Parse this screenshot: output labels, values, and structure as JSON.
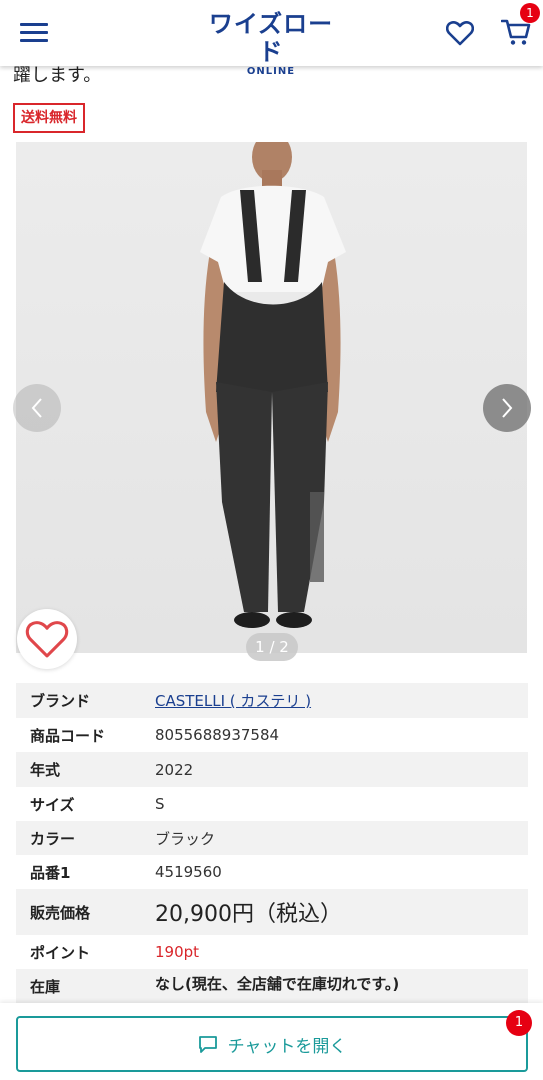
{
  "header": {
    "logo_main": "ワイズロード",
    "logo_sub": "ONLINE",
    "cart_count": "1"
  },
  "description_tail": "躍します。",
  "badge_free_shipping": "送料無料",
  "gallery": {
    "pager": "1 / 2"
  },
  "specs": [
    {
      "label": "ブランド",
      "value": "CASTELLI ( カステリ )"
    },
    {
      "label": "商品コード",
      "value": "8055688937584"
    },
    {
      "label": "年式",
      "value": "2022"
    },
    {
      "label": "サイズ",
      "value": "S"
    },
    {
      "label": "カラー",
      "value": "ブラック"
    },
    {
      "label": "品番1",
      "value": "4519560"
    },
    {
      "label": "販売価格",
      "value": "20,900円（税込）"
    },
    {
      "label": "ポイント",
      "value": "190pt"
    },
    {
      "label": "在庫",
      "value": "なし(現在、全店舗で在庫切れです。)"
    }
  ],
  "chat": {
    "label": "チャットを開く",
    "badge": "1"
  },
  "colors": {
    "brand_blue": "#1a3f8f",
    "accent_red": "#d9262b",
    "chat_teal": "#1a9a9a",
    "badge_red": "#e60012"
  }
}
